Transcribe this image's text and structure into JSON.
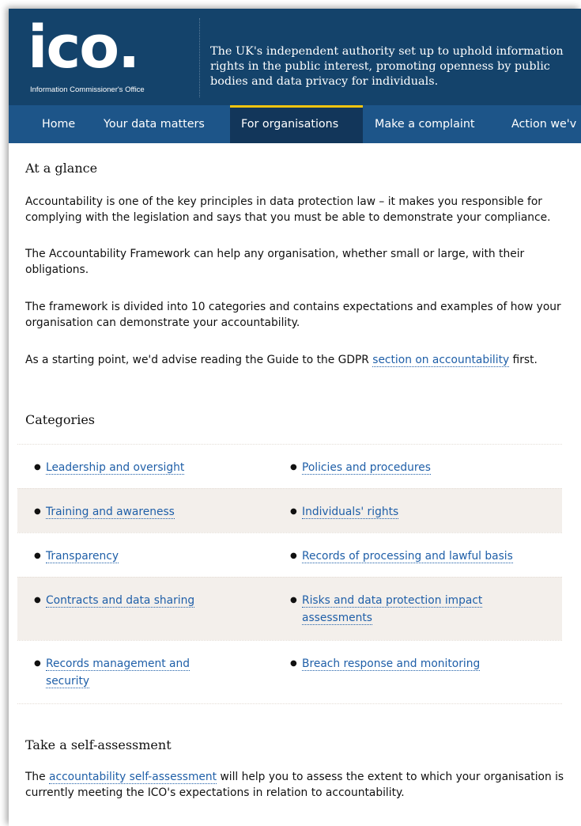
{
  "header": {
    "logo_text": "ico.",
    "logo_sub": "Information Commissioner's Office",
    "tagline": "The UK's independent authority set up to uphold information rights in the public interest, promoting openness by public bodies and data privacy for individuals."
  },
  "nav": {
    "items": [
      {
        "label": "Home"
      },
      {
        "label": "Your data matters"
      },
      {
        "label": "For organisations",
        "active": true
      },
      {
        "label": "Make a complaint"
      },
      {
        "label": "Action we'v"
      }
    ]
  },
  "glance": {
    "heading": "At a glance",
    "p1": "Accountability is one of the key principles in data protection law – it makes you responsible for complying with the legislation and says that you must be able to demonstrate your compliance.",
    "p2": "The Accountability Framework can help any organisation, whether small or large, with their obligations.",
    "p3": "The framework is divided into 10 categories and contains expectations and examples of how your organisation can demonstrate your accountability.",
    "p4_before": "As a starting point, we'd advise reading the Guide to the GDPR ",
    "p4_link": "section on accountability",
    "p4_after": " first."
  },
  "categories": {
    "heading": "Categories",
    "items": [
      {
        "label": "Leadership and oversight"
      },
      {
        "label": "Policies and procedures"
      },
      {
        "label": "Training and awareness"
      },
      {
        "label": "Individuals' rights"
      },
      {
        "label": "Transparency"
      },
      {
        "label": "Records of processing and lawful basis"
      },
      {
        "label": "Contracts and data sharing"
      },
      {
        "label": "Risks and data protection impact assessments"
      },
      {
        "label": "Records management and security"
      },
      {
        "label": "Breach response and monitoring"
      }
    ]
  },
  "self_assessment": {
    "heading": "Take a self-assessment",
    "before": "The ",
    "link": "accountability self-assessment",
    "after": " will help you to assess the extent to which your organisation is currently meeting the ICO's expectations in relation to accountability."
  },
  "colors": {
    "header_bg": "#14436b",
    "nav_bg": "#1d5589",
    "nav_active": "#12365a",
    "accent_yellow": "#f2c40f",
    "link": "#1f5fa8",
    "row_shade": "#f3efeb"
  }
}
